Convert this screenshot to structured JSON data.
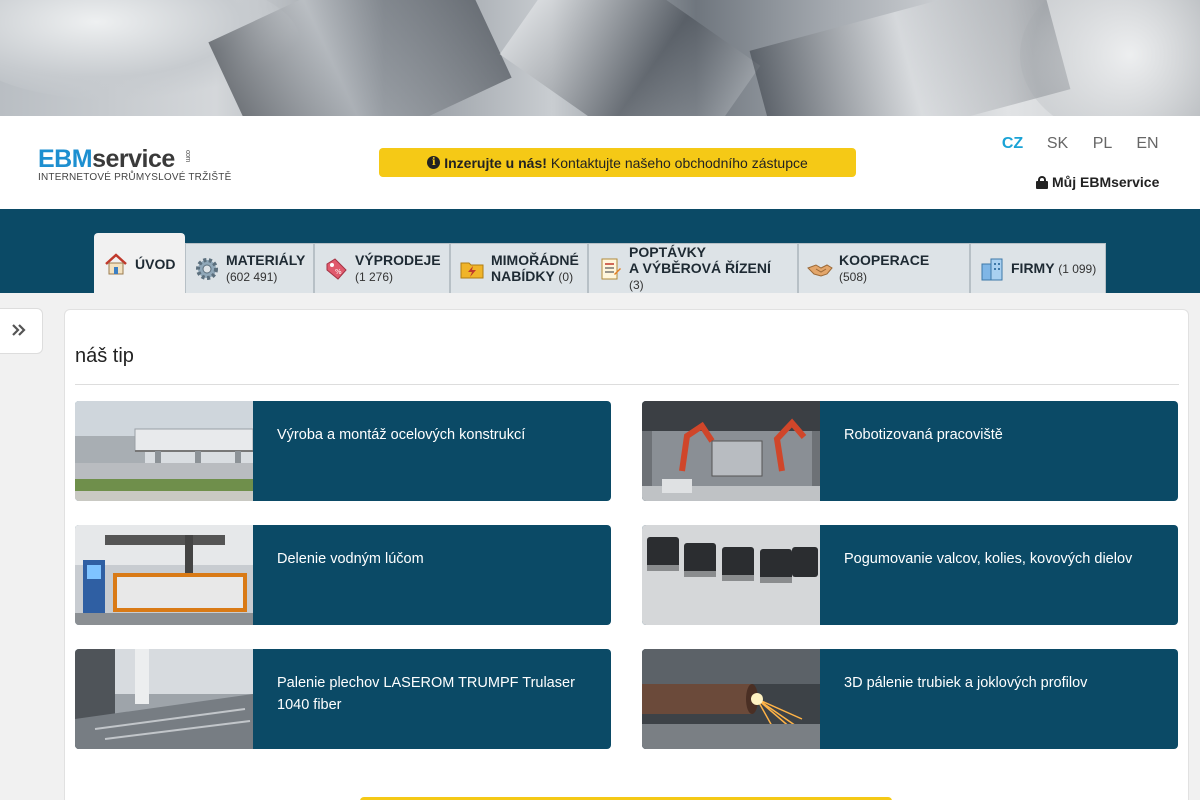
{
  "logo": {
    "part1": "EBM",
    "part2": "service",
    "suffix": "com",
    "tagline": "INTERNETOVÉ PRŮMYSLOVÉ TRŽIŠTĚ"
  },
  "ad_bar": {
    "bold": "Inzerujte u nás!",
    "text": "Kontaktujte našeho obchodního zástupce"
  },
  "languages": [
    {
      "code": "CZ",
      "active": true
    },
    {
      "code": "SK",
      "active": false
    },
    {
      "code": "PL",
      "active": false
    },
    {
      "code": "EN",
      "active": false
    }
  ],
  "account_link": "Můj EBMservice",
  "nav_tabs": [
    {
      "label": "ÚVOD",
      "count": "",
      "icon": "home-icon"
    },
    {
      "label": "MATERIÁLY",
      "count": "(602 491)",
      "icon": "gear-icon"
    },
    {
      "label": "VÝPRODEJE",
      "count": "(1 276)",
      "icon": "price-tag-icon"
    },
    {
      "label1": "MIMOŘÁDNÉ",
      "label2": "NABÍDKY",
      "count": "(0)",
      "icon": "folder-lightning-icon"
    },
    {
      "label1": "POPTÁVKY",
      "label2": "A VÝBĚROVÁ ŘÍZENÍ",
      "count": "(3)",
      "icon": "document-list-icon"
    },
    {
      "label": "KOOPERACE",
      "count": "(508)",
      "icon": "handshake-icon"
    },
    {
      "label": "FIRMY",
      "count": "(1 099)",
      "icon": "buildings-icon"
    }
  ],
  "section_title": "náš tip",
  "tips": [
    {
      "title": "Výroba a montáž ocelových konstrukcí",
      "image": "steel-structure-photo"
    },
    {
      "title": "Robotizovaná pracoviště",
      "image": "robot-cell-photo"
    },
    {
      "title": "Delenie vodným lúčom",
      "image": "waterjet-machine-photo"
    },
    {
      "title": "Pogumovanie valcov, kolies, kovových dielov",
      "image": "rubber-coated-parts-photo"
    },
    {
      "title": "Palenie plechov LASEROM TRUMPF Trulaser 1040 fiber",
      "image": "laser-cutting-photo"
    },
    {
      "title": "3D pálenie trubiek a joklových profilov",
      "image": "tube-cutting-sparks-photo"
    }
  ],
  "colors": {
    "brand_blue": "#1d8fd0",
    "nav_bg": "#0b4a66",
    "accent_yellow": "#f5c916",
    "active_lang": "#1aa3d6"
  }
}
